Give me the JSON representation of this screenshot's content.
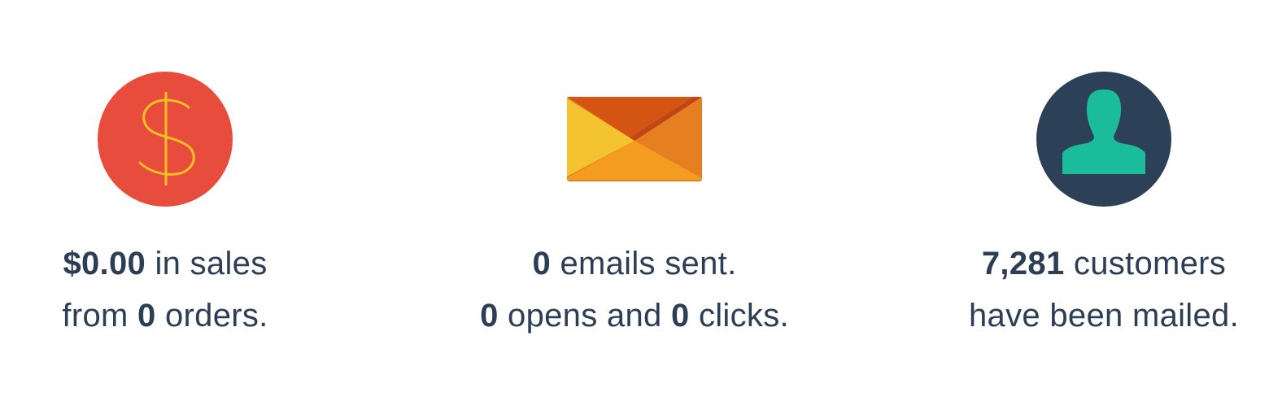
{
  "stats": {
    "sales": {
      "icon": "dollar-icon",
      "color": "#e74c3c",
      "amount": "$0.00",
      "text_in_sales": " in sales",
      "text_from": "from ",
      "orders": "0",
      "text_orders": " orders."
    },
    "emails": {
      "icon": "envelope-icon",
      "sent": "0",
      "text_sent": " emails sent.",
      "opens": "0",
      "text_opens_and": " opens and ",
      "clicks": "0",
      "text_clicks": " clicks."
    },
    "customers": {
      "icon": "customer-icon",
      "circle_color": "#2c4057",
      "figure_color": "#1abc9c",
      "count": "7,281",
      "text_customers": " customers",
      "text_mailed": "have been mailed."
    }
  }
}
